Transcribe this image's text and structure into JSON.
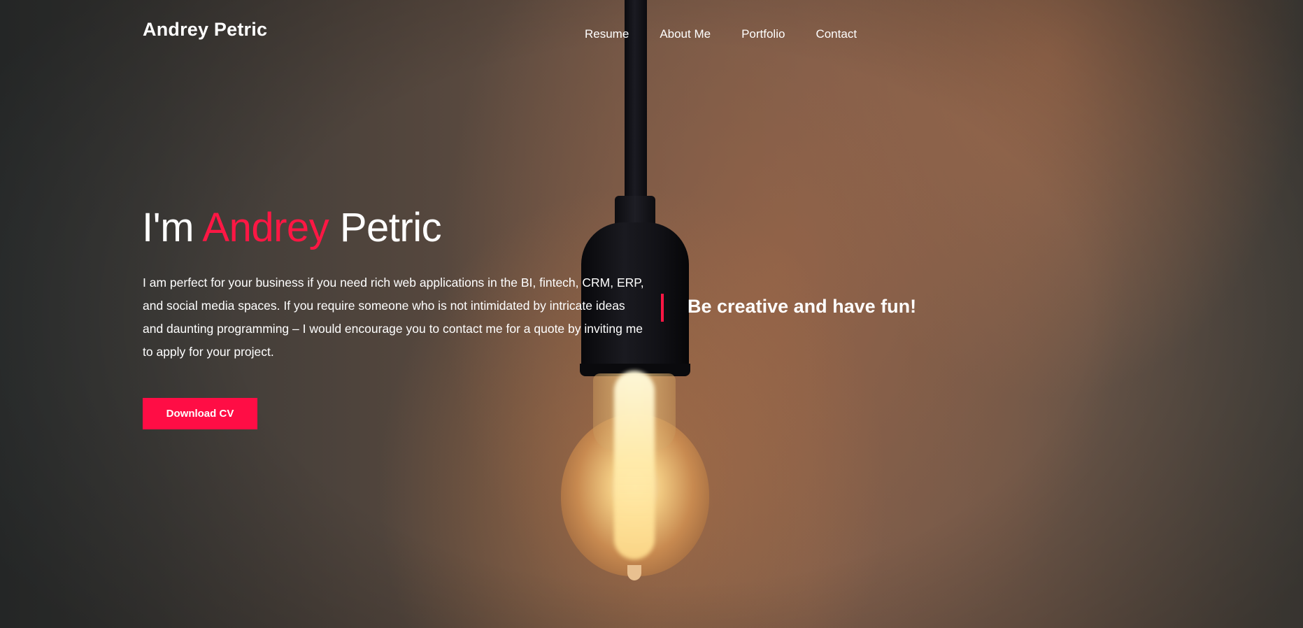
{
  "header": {
    "logo": "Andrey Petric",
    "nav": [
      {
        "label": "Resume"
      },
      {
        "label": "About Me"
      },
      {
        "label": "Portfolio"
      },
      {
        "label": "Contact"
      }
    ]
  },
  "hero": {
    "greeting": "I'm ",
    "first_name": "Andrey",
    "last_name": " Petric",
    "intro": "I am perfect for your business if you need rich web applications in the BI, fintech, CRM, ERP, and social media spaces. If you require someone who is not intimidated by intricate ideas and daunting programming – I would encourage you to contact me for a quote by inviting me to apply for your project.",
    "cta_label": "Download CV",
    "quote": "Be creative and have fun!",
    "background_image": "light-bulb-photo"
  },
  "colors": {
    "accent": "#ff1744",
    "button": "#ff0d45",
    "text": "#ffffff"
  }
}
